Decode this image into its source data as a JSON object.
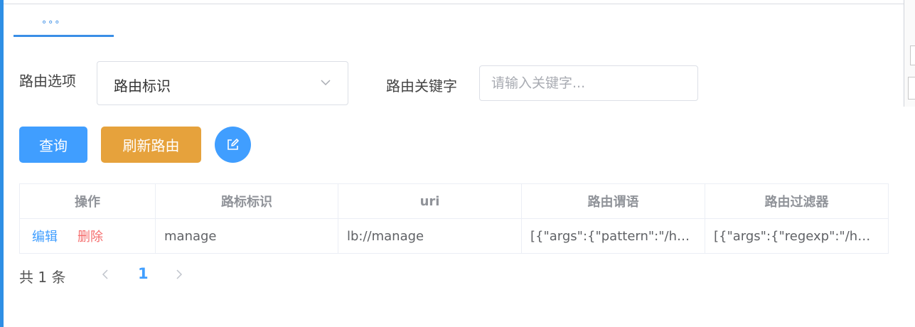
{
  "tab": {
    "label": "∘∘∘"
  },
  "filters": {
    "route_option_label": "路由选项",
    "route_option_value": "路由标识",
    "route_keyword_label": "路由关键字",
    "route_keyword_placeholder": "请输入关键字...",
    "route_keyword_value": ""
  },
  "toolbar": {
    "query_label": "查询",
    "refresh_label": "刷新路由"
  },
  "table": {
    "columns": [
      "操作",
      "路标标识",
      "uri",
      "路由谓语",
      "路由过滤器"
    ],
    "rows": [
      {
        "edit_label": "编辑",
        "delete_label": "删除",
        "route_id": "manage",
        "uri": "lb://manage",
        "predicates": "[{\"args\":{\"pattern\":\"/hm...",
        "filters": "[{\"args\":{\"regexp\":\"/hm..."
      }
    ]
  },
  "pagination": {
    "total_text": "共 1 条",
    "current_page": "1"
  },
  "colors": {
    "primary": "#409eff",
    "warning": "#e6a23c",
    "danger": "#f56c6c"
  }
}
